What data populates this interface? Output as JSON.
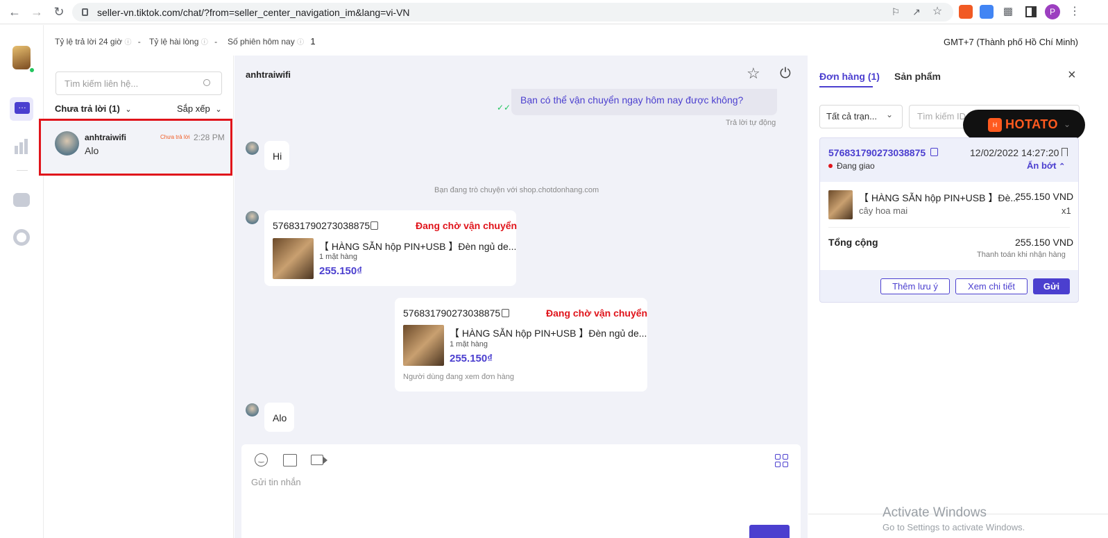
{
  "browser": {
    "url": "seller-vn.tiktok.com/chat/?from=seller_center_navigation_im&lang=vi-VN",
    "profile_initial": "P"
  },
  "stats": {
    "reply_rate_label": "Tỷ lệ trả lời 24 giờ",
    "reply_rate_value": "-",
    "satisfaction_label": "Tỷ lệ hài lòng",
    "satisfaction_value": "-",
    "sessions_label": "Số phiên hôm nay",
    "sessions_value": "1",
    "timezone": "GMT+7 (Thành phố Hồ Chí Minh)"
  },
  "contacts": {
    "search_placeholder": "Tìm kiếm liên hệ...",
    "filter_label": "Chưa trả lời (1)",
    "sort_label": "Sắp xếp",
    "items": [
      {
        "name": "anhtraiwifi",
        "badge": "Chưa trả lời",
        "time": "2:28 PM",
        "preview": "Alo"
      }
    ]
  },
  "chat": {
    "title": "anhtraiwifi",
    "auto_msg_cut": "Bạn có thể vận chuyển ngay hôm nay được không?",
    "auto_reply_label": "Trả lời tự động",
    "msg_hi": "Hi",
    "system_notice": "Bạn đang trò chuyện với shop.chotdonhang.com",
    "order_card_1": {
      "order_id": "576831790273038875",
      "status": "Đang chờ vận chuyển",
      "product": "【 HÀNG SẴN hộp PIN+USB 】Đèn ngủ de...",
      "qty": "1 mặt hàng",
      "price": "255.150₫"
    },
    "order_card_2": {
      "order_id": "576831790273038875",
      "status": "Đang chờ vận chuyển",
      "product": "【 HÀNG SẴN hộp PIN+USB 】Đèn ngủ de...",
      "qty": "1 mặt hàng",
      "price": "255.150₫",
      "note": "Người dùng đang xem đơn hàng"
    },
    "msg_alo": "Alo",
    "composer_placeholder": "Gửi tin nhắn"
  },
  "right": {
    "tab_orders": "Đơn hàng (1)",
    "tab_products": "Sản phẩm",
    "status_filter": "Tất cả trạn...",
    "search_id_placeholder": "Tìm kiếm ID",
    "hotato": "HOTATO",
    "order": {
      "order_id": "576831790273038875",
      "datetime": "12/02/2022 14:27:20",
      "status": "Đang giao",
      "collapse_label": "Ẩn bớt",
      "product": "【 HÀNG SẴN hộp PIN+USB 】Đè...",
      "variant": "cây hoa mai",
      "price": "255.150 VND",
      "qty": "x1",
      "total_label": "Tổng cộng",
      "total_value": "255.150 VND",
      "payment": "Thanh toán khi nhận hàng",
      "btn_note": "Thêm lưu ý",
      "btn_detail": "Xem chi tiết",
      "btn_send": "Gửi"
    },
    "watermark_title": "Activate Windows",
    "watermark_sub": "Go to Settings to activate Windows."
  },
  "colors": {
    "accent": "#4b3fcf",
    "status_red": "#e0141b",
    "hotato": "#ff5a1f"
  }
}
